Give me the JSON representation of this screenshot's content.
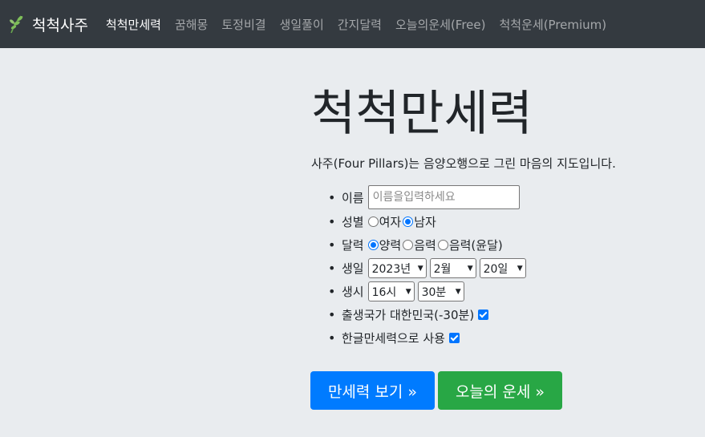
{
  "brand": {
    "name": "척척사주",
    "icon": "leaf-icon",
    "icon_color": "#7fbf5a"
  },
  "nav": [
    {
      "label": "척척만세력",
      "active": true
    },
    {
      "label": "꿈해몽"
    },
    {
      "label": "토정비결"
    },
    {
      "label": "생일풀이"
    },
    {
      "label": "간지달력"
    },
    {
      "label": "오늘의운세(Free)"
    },
    {
      "label": "척척운세(Premium)"
    }
  ],
  "main": {
    "title": "척척만세력",
    "lead": "사주(Four Pillars)는 음양오행으로 그린 마음의 지도입니다."
  },
  "form": {
    "name": {
      "label": "이름",
      "placeholder": "이름을입력하세요",
      "value": ""
    },
    "gender": {
      "label": "성별",
      "options": [
        "여자",
        "남자"
      ],
      "selected": "남자"
    },
    "calendar": {
      "label": "달력",
      "options": [
        "양력",
        "음력",
        "음력(윤달)"
      ],
      "selected": "양력"
    },
    "birthdate": {
      "label": "생일",
      "year": "2023년",
      "month": "2월",
      "day": "20일"
    },
    "birthtime": {
      "label": "생시",
      "hour": "16시",
      "minute": "30분"
    },
    "country": {
      "label": "출생국가 대한민국(-30분)",
      "checked": true
    },
    "hangul": {
      "label": "한글만세력으로 사용",
      "checked": true
    }
  },
  "buttons": {
    "view": "만세력 보기 »",
    "today": "오늘의 운세 »"
  },
  "colors": {
    "navbar": "#343a40",
    "background": "#e9ecef",
    "primary": "#007bff",
    "success": "#28a745"
  }
}
